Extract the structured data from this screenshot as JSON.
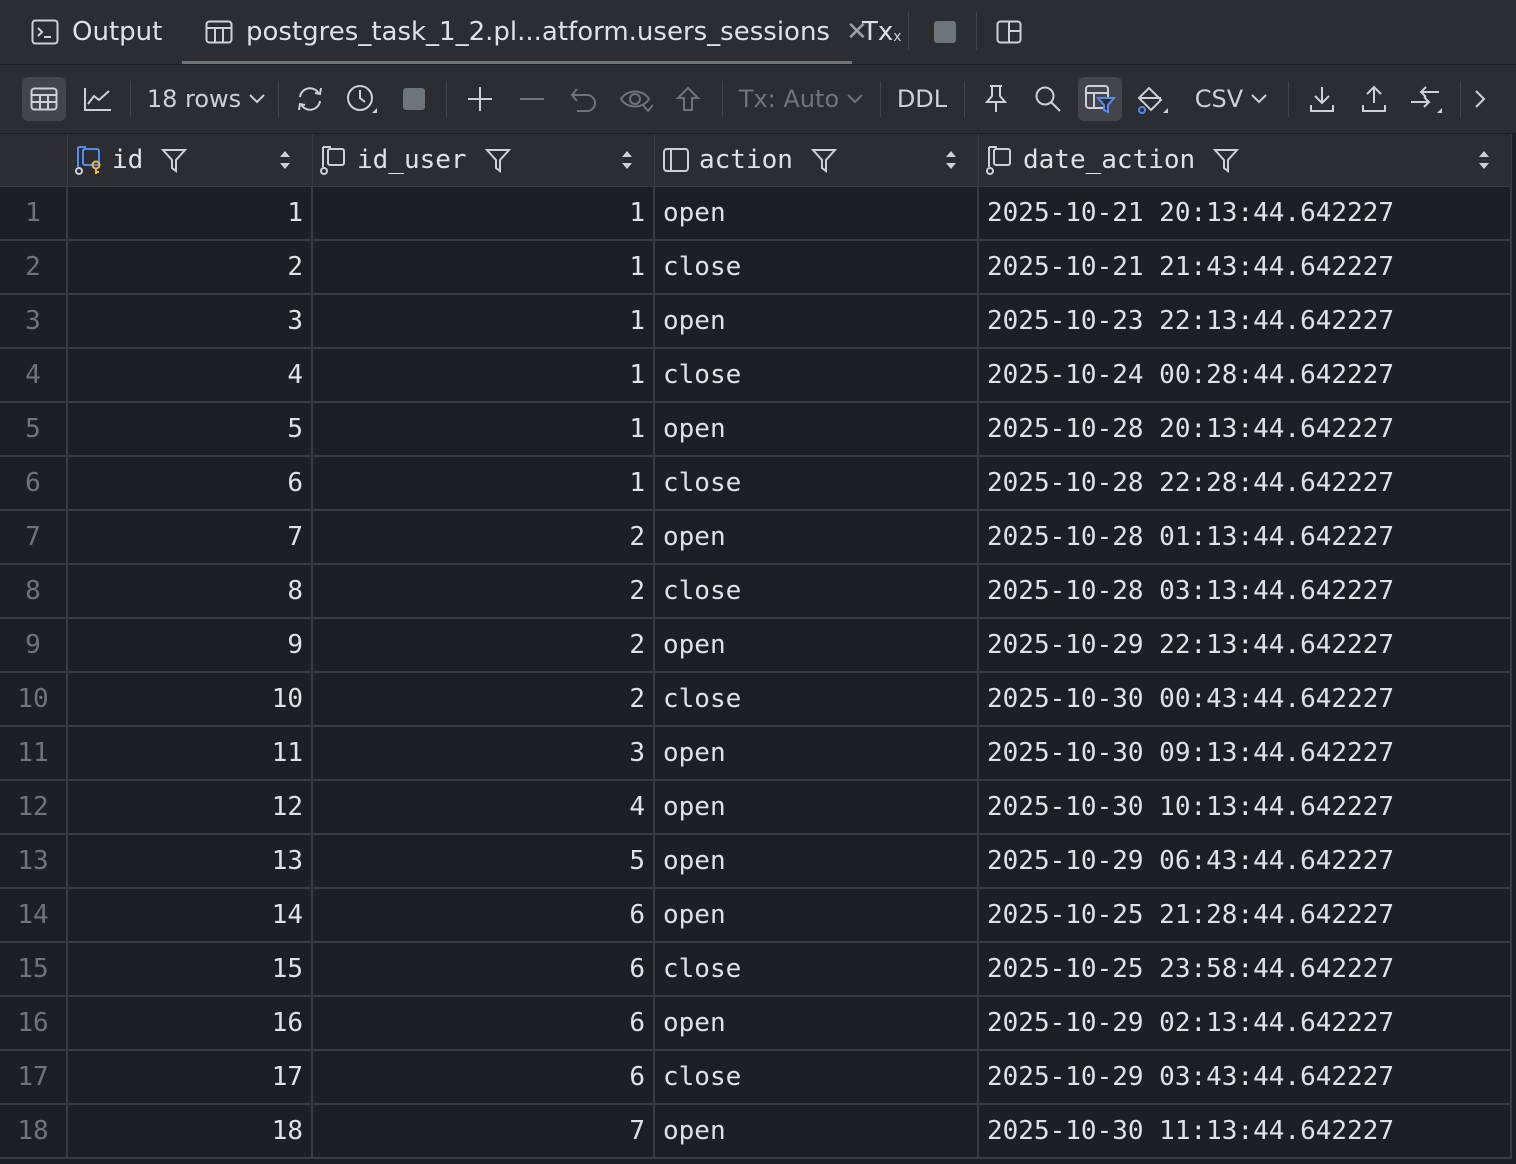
{
  "tabs": {
    "output": "Output",
    "table": "postgres_task_1_2.pl...atform.users_sessions",
    "tx": "Tx"
  },
  "toolbar": {
    "rows_label": "18 rows",
    "tx_mode": "Tx: Auto",
    "ddl": "DDL",
    "export_format": "CSV"
  },
  "columns": [
    "id",
    "id_user",
    "action",
    "date_action"
  ],
  "rows": [
    {
      "n": "1",
      "id": "1",
      "id_user": "1",
      "action": "open",
      "date_action": "2025-10-21 20:13:44.642227"
    },
    {
      "n": "2",
      "id": "2",
      "id_user": "1",
      "action": "close",
      "date_action": "2025-10-21 21:43:44.642227"
    },
    {
      "n": "3",
      "id": "3",
      "id_user": "1",
      "action": "open",
      "date_action": "2025-10-23 22:13:44.642227"
    },
    {
      "n": "4",
      "id": "4",
      "id_user": "1",
      "action": "close",
      "date_action": "2025-10-24 00:28:44.642227"
    },
    {
      "n": "5",
      "id": "5",
      "id_user": "1",
      "action": "open",
      "date_action": "2025-10-28 20:13:44.642227"
    },
    {
      "n": "6",
      "id": "6",
      "id_user": "1",
      "action": "close",
      "date_action": "2025-10-28 22:28:44.642227"
    },
    {
      "n": "7",
      "id": "7",
      "id_user": "2",
      "action": "open",
      "date_action": "2025-10-28 01:13:44.642227"
    },
    {
      "n": "8",
      "id": "8",
      "id_user": "2",
      "action": "close",
      "date_action": "2025-10-28 03:13:44.642227"
    },
    {
      "n": "9",
      "id": "9",
      "id_user": "2",
      "action": "open",
      "date_action": "2025-10-29 22:13:44.642227"
    },
    {
      "n": "10",
      "id": "10",
      "id_user": "2",
      "action": "close",
      "date_action": "2025-10-30 00:43:44.642227"
    },
    {
      "n": "11",
      "id": "11",
      "id_user": "3",
      "action": "open",
      "date_action": "2025-10-30 09:13:44.642227"
    },
    {
      "n": "12",
      "id": "12",
      "id_user": "4",
      "action": "open",
      "date_action": "2025-10-30 10:13:44.642227"
    },
    {
      "n": "13",
      "id": "13",
      "id_user": "5",
      "action": "open",
      "date_action": "2025-10-29 06:43:44.642227"
    },
    {
      "n": "14",
      "id": "14",
      "id_user": "6",
      "action": "open",
      "date_action": "2025-10-25 21:28:44.642227"
    },
    {
      "n": "15",
      "id": "15",
      "id_user": "6",
      "action": "close",
      "date_action": "2025-10-25 23:58:44.642227"
    },
    {
      "n": "16",
      "id": "16",
      "id_user": "6",
      "action": "open",
      "date_action": "2025-10-29 02:13:44.642227"
    },
    {
      "n": "17",
      "id": "17",
      "id_user": "6",
      "action": "close",
      "date_action": "2025-10-29 03:43:44.642227"
    },
    {
      "n": "18",
      "id": "18",
      "id_user": "7",
      "action": "open",
      "date_action": "2025-10-30 11:13:44.642227"
    }
  ]
}
